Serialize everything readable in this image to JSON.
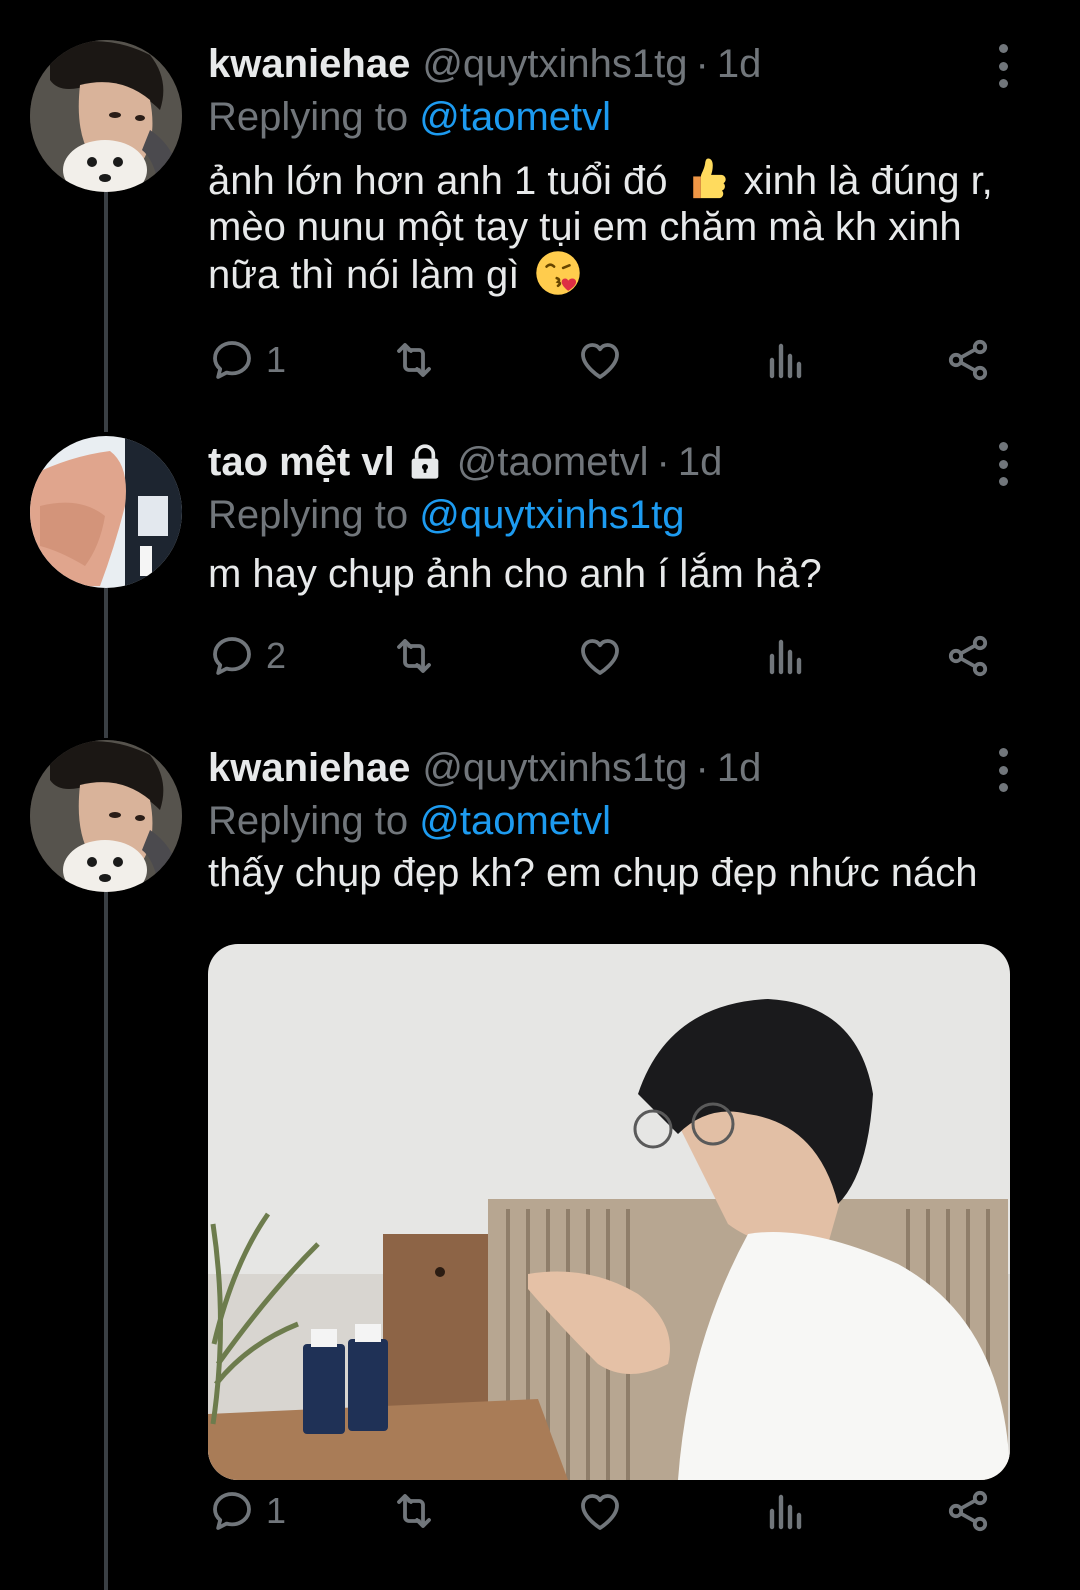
{
  "colors": {
    "background": "#000000",
    "text": "#e7e9ea",
    "secondary": "#71767b",
    "accent": "#1d9bf0",
    "thread_line": "#3a3f44"
  },
  "tweets": [
    {
      "display_name": "kwaniehae",
      "handle": "@quytxinhs1tg",
      "separator": "·",
      "time": "1d",
      "replying_prefix": "Replying to",
      "replying_to": "@taometvl",
      "text_lines": [
        "ảnh lớn hơn anh 1 tuổi đó",
        "xinh là đúng r,",
        "mèo nunu một tay tụi em chăm mà kh xinh",
        "nữa thì nói làm gì"
      ],
      "emojis": [
        "thumbs-up-emoji",
        "kissing-heart-emoji"
      ],
      "reply_count": "1",
      "locked": false
    },
    {
      "display_name": "tao mệt vl",
      "handle": "@taometvl",
      "separator": "·",
      "time": "1d",
      "replying_prefix": "Replying to",
      "replying_to": "@quytxinhs1tg",
      "text": "m hay chụp ảnh cho anh í lắm hả?",
      "reply_count": "2",
      "locked": true
    },
    {
      "display_name": "kwaniehae",
      "handle": "@quytxinhs1tg",
      "separator": "·",
      "time": "1d",
      "replying_prefix": "Replying to",
      "replying_to": "@taometvl",
      "text": "thấy chụp đẹp kh? em chụp đẹp nhức nách",
      "reply_count": "1",
      "locked": false,
      "media": "photo"
    }
  ],
  "icons": [
    "reply-icon",
    "retweet-icon",
    "like-icon",
    "analytics-icon",
    "share-icon",
    "more-options-icon",
    "lock-icon"
  ]
}
